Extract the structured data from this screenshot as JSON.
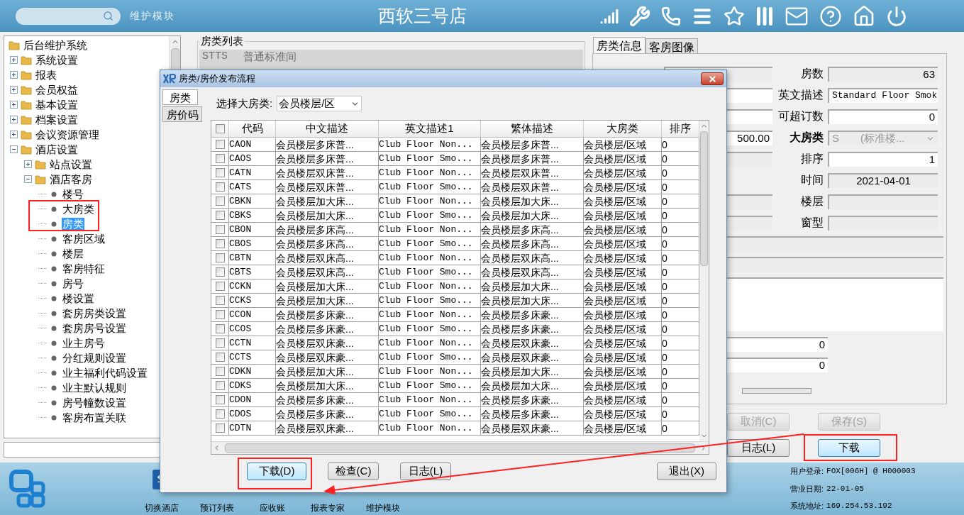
{
  "top_bar": {
    "module_label": "维护模块",
    "title": "西软三号店"
  },
  "tree": {
    "root": {
      "label": "后台维护系统",
      "children": [
        {
          "label": "系统设置",
          "expanded": false
        },
        {
          "label": "报表",
          "expanded": false
        },
        {
          "label": "会员权益",
          "expanded": false
        },
        {
          "label": "基本设置",
          "expanded": false
        },
        {
          "label": "档案设置",
          "expanded": false
        },
        {
          "label": "会议资源管理",
          "expanded": false
        },
        {
          "label": "酒店设置",
          "expanded": true,
          "children": [
            {
              "label": "站点设置",
              "expanded": false
            },
            {
              "label": "酒店客房",
              "expanded": true,
              "children": [
                {
                  "label": "楼号",
                  "selected": false
                },
                {
                  "label": "大房类",
                  "selected": false
                },
                {
                  "label": "房类",
                  "selected": true
                },
                {
                  "label": "客房区域",
                  "selected": false
                },
                {
                  "label": "楼层",
                  "selected": false
                },
                {
                  "label": "客房特征",
                  "selected": false
                },
                {
                  "label": "房号",
                  "selected": false
                },
                {
                  "label": "楼设置",
                  "selected": false
                },
                {
                  "label": "套房房类设置",
                  "selected": false
                },
                {
                  "label": "套房房号设置",
                  "selected": false
                },
                {
                  "label": "业主房号",
                  "selected": false
                },
                {
                  "label": "分红规则设置",
                  "selected": false
                },
                {
                  "label": "业主福利代码设置",
                  "selected": false
                },
                {
                  "label": "业主默认规则",
                  "selected": false
                },
                {
                  "label": "房号幢数设置",
                  "selected": false
                },
                {
                  "label": "客房布置关联",
                  "selected": false
                }
              ]
            }
          ]
        }
      ]
    }
  },
  "room_type_list": {
    "title": "房类列表",
    "rows": [
      {
        "code": "STTS",
        "name": "普通标准间"
      }
    ]
  },
  "detail_panel": {
    "tabs": [
      {
        "label": "房类信息",
        "selected": true
      },
      {
        "label": "客房图像",
        "selected": false
      }
    ],
    "rows": [
      {
        "left": {
          "kind": "text",
          "readonly": true
        },
        "right": {
          "label": "房数",
          "bold": false,
          "kind": "number",
          "readonly": true,
          "value": "63"
        }
      },
      {
        "left": {
          "kind": "text",
          "readonly": false
        },
        "right": {
          "label": "英文描述",
          "bold": false,
          "kind": "text",
          "readonly": false,
          "value": "Standard Floor Smok"
        }
      },
      {
        "left": {
          "kind": "text",
          "readonly": false
        },
        "right": {
          "label": "可超订数",
          "bold": false,
          "kind": "number",
          "readonly": false,
          "value": "0"
        }
      },
      {
        "left": {
          "kind": "number",
          "readonly": false,
          "value": "500.00"
        },
        "right": {
          "label": "大房类",
          "bold": true,
          "kind": "select",
          "readonly": true,
          "value_code": "S",
          "value": "(标准楼..."
        }
      },
      {
        "left": {
          "kind": "text",
          "readonly": true
        },
        "right": {
          "label": "排序",
          "bold": false,
          "kind": "number",
          "readonly": false,
          "value": "1"
        }
      },
      {
        "right": {
          "label": "时间",
          "bold": false,
          "kind": "date",
          "readonly": true,
          "value": "2021-04-01"
        }
      },
      {
        "left": {
          "kind": "text",
          "readonly": true
        },
        "right": {
          "label": "楼层",
          "bold": false,
          "kind": "text",
          "readonly": true
        }
      },
      {
        "left": {
          "kind": "text",
          "readonly": true
        },
        "right": {
          "label": "窗型",
          "bold": false,
          "kind": "text",
          "readonly": true
        }
      }
    ],
    "extra_fields": [
      {
        "kind": "text",
        "readonly": true
      },
      {
        "kind": "text",
        "readonly": true
      },
      {
        "kind": "textarea",
        "readonly": false
      },
      {
        "kind": "number",
        "readonly": false,
        "value": "0"
      },
      {
        "kind": "number",
        "readonly": false,
        "value": "0"
      }
    ],
    "buttons": [
      {
        "label": "取消(C)",
        "disabled": true,
        "default": false
      },
      {
        "label": "保存(S)",
        "disabled": true,
        "default": false
      },
      {
        "label": "日志(L)",
        "disabled": false,
        "default": false
      },
      {
        "label": "下载",
        "disabled": false,
        "default": true
      }
    ]
  },
  "dialog": {
    "title": "房类/房价发布流程",
    "tabs": [
      {
        "label": "房类",
        "selected": true
      },
      {
        "label": "房价码",
        "selected": false
      }
    ],
    "filter": {
      "label": "选择大房类:",
      "value": "会员楼层/区"
    },
    "table": {
      "select_all": {
        "checked": false
      },
      "columns": [
        "代码",
        "中文描述",
        "英文描述1",
        "繁体描述",
        "大房类",
        "排序"
      ],
      "rows": [
        {
          "checked": false,
          "cells": [
            "CAON",
            "会员楼层多床普...",
            "Club Floor Non...",
            "会员楼层多床普...",
            "会员楼层/区域",
            "0"
          ]
        },
        {
          "checked": false,
          "cells": [
            "CAOS",
            "会员楼层多床普...",
            "Club Floor Smo...",
            "会员楼层多床普...",
            "会员楼层/区域",
            "0"
          ]
        },
        {
          "checked": false,
          "cells": [
            "CATN",
            "会员楼层双床普...",
            "Club Floor Non...",
            "会员楼层双床普...",
            "会员楼层/区域",
            "0"
          ]
        },
        {
          "checked": false,
          "cells": [
            "CATS",
            "会员楼层双床普...",
            "Club Floor Smo...",
            "会员楼层双床普...",
            "会员楼层/区域",
            "0"
          ]
        },
        {
          "checked": false,
          "cells": [
            "CBKN",
            "会员楼层加大床...",
            "Club Floor Non...",
            "会员楼层加大床...",
            "会员楼层/区域",
            "0"
          ]
        },
        {
          "checked": false,
          "cells": [
            "CBKS",
            "会员楼层加大床...",
            "Club Floor Smo...",
            "会员楼层加大床...",
            "会员楼层/区域",
            "0"
          ]
        },
        {
          "checked": false,
          "cells": [
            "CBON",
            "会员楼层多床高...",
            "Club Floor Non...",
            "会员楼层多床高...",
            "会员楼层/区域",
            "0"
          ]
        },
        {
          "checked": false,
          "cells": [
            "CBOS",
            "会员楼层多床高...",
            "Club Floor Smo...",
            "会员楼层多床高...",
            "会员楼层/区域",
            "0"
          ]
        },
        {
          "checked": false,
          "cells": [
            "CBTN",
            "会员楼层双床高...",
            "Club Floor Non...",
            "会员楼层双床高...",
            "会员楼层/区域",
            "0"
          ]
        },
        {
          "checked": false,
          "cells": [
            "CBTS",
            "会员楼层双床高...",
            "Club Floor Smo...",
            "会员楼层双床高...",
            "会员楼层/区域",
            "0"
          ]
        },
        {
          "checked": false,
          "cells": [
            "CCKN",
            "会员楼层加大床...",
            "Club Floor Non...",
            "会员楼层加大床...",
            "会员楼层/区域",
            "0"
          ]
        },
        {
          "checked": false,
          "cells": [
            "CCKS",
            "会员楼层加大床...",
            "Club Floor Smo...",
            "会员楼层加大床...",
            "会员楼层/区域",
            "0"
          ]
        },
        {
          "checked": false,
          "cells": [
            "CCON",
            "会员楼层多床豪...",
            "Club Floor Non...",
            "会员楼层多床豪...",
            "会员楼层/区域",
            "0"
          ]
        },
        {
          "checked": false,
          "cells": [
            "CCOS",
            "会员楼层多床豪...",
            "Club Floor Smo...",
            "会员楼层多床豪...",
            "会员楼层/区域",
            "0"
          ]
        },
        {
          "checked": false,
          "cells": [
            "CCTN",
            "会员楼层双床豪...",
            "Club Floor Non...",
            "会员楼层双床豪...",
            "会员楼层/区域",
            "0"
          ]
        },
        {
          "checked": false,
          "cells": [
            "CCTS",
            "会员楼层双床豪...",
            "Club Floor Smo...",
            "会员楼层双床豪...",
            "会员楼层/区域",
            "0"
          ]
        },
        {
          "checked": false,
          "cells": [
            "CDKN",
            "会员楼层加大床...",
            "Club Floor Non...",
            "会员楼层加大床...",
            "会员楼层/区域",
            "0"
          ]
        },
        {
          "checked": false,
          "cells": [
            "CDKS",
            "会员楼层加大床...",
            "Club Floor Smo...",
            "会员楼层加大床...",
            "会员楼层/区域",
            "0"
          ]
        },
        {
          "checked": false,
          "cells": [
            "CDON",
            "会员楼层多床豪...",
            "Club Floor Non...",
            "会员楼层多床豪...",
            "会员楼层/区域",
            "0"
          ]
        },
        {
          "checked": false,
          "cells": [
            "CDOS",
            "会员楼层多床豪...",
            "Club Floor Smo...",
            "会员楼层多床豪...",
            "会员楼层/区域",
            "0"
          ]
        },
        {
          "checked": false,
          "cells": [
            "CDTN",
            "会员楼层双床豪...",
            "Club Floor Non...",
            "会员楼层双床豪...",
            "会员楼层/区域",
            "0"
          ]
        }
      ]
    },
    "buttons": [
      {
        "label": "下载(D)",
        "default": true
      },
      {
        "label": "检查(C)",
        "default": false
      },
      {
        "label": "日志(L)",
        "default": false
      },
      {
        "label": "退出(X)",
        "default": false
      }
    ]
  },
  "bottom_bar": {
    "items": [
      "切换酒店",
      "预订列表",
      "应收账",
      "报表专家",
      "维护模块"
    ],
    "status": [
      {
        "label": "用户登录:",
        "value": "FOX[006H] @ H000003"
      },
      {
        "label": "营业日期:",
        "value": "22-01-05"
      },
      {
        "label": "系统地址:",
        "value": "169.254.53.192"
      }
    ]
  }
}
